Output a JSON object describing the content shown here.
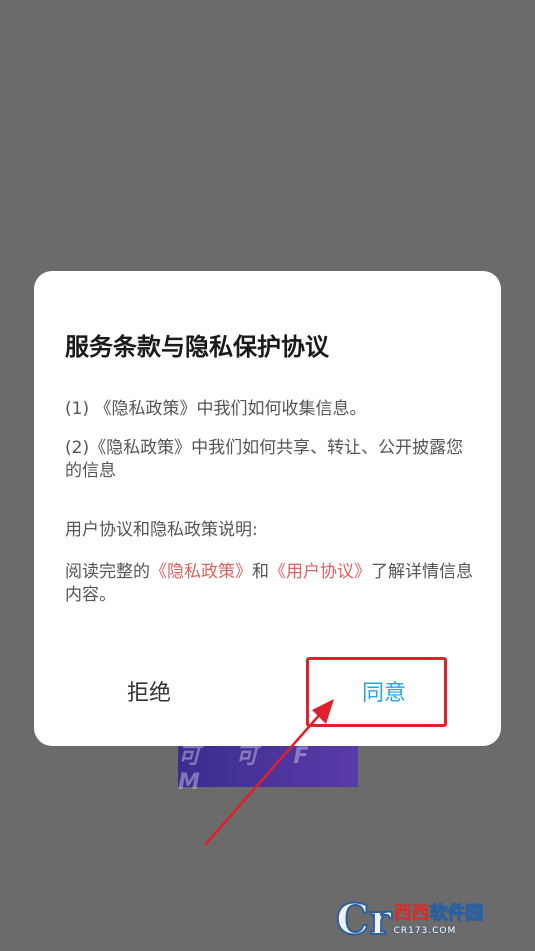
{
  "background_banner": {
    "text": "可 可 F M"
  },
  "dialog": {
    "title": "服务条款与隐私保护协议",
    "item1": "(1) 《隐私政策》中我们如何收集信息。",
    "item2": "(2)《隐私政策》中我们如何共享、转让、公开披露您的信息",
    "section_heading": "用户协议和隐私政策说明:",
    "read_prefix": "阅读完整的",
    "privacy_link": "《隐私政策》",
    "and_text": "和",
    "user_agreement_link": "《用户协议》",
    "read_suffix": "了解详情信息内容。",
    "reject_label": "拒绝",
    "agree_label": "同意"
  },
  "annotation": {
    "highlight_color": "#e0202a"
  },
  "watermark": {
    "logo_letter": "Cr",
    "brand_part1": "西西",
    "brand_part2": "软件园",
    "domain": "CR173.COM"
  },
  "colors": {
    "overlay_bg": "#6b6b6b",
    "agree_blue": "#27a3e8",
    "link_red": "#e06060",
    "banner_purple": "#3a2d8f"
  }
}
